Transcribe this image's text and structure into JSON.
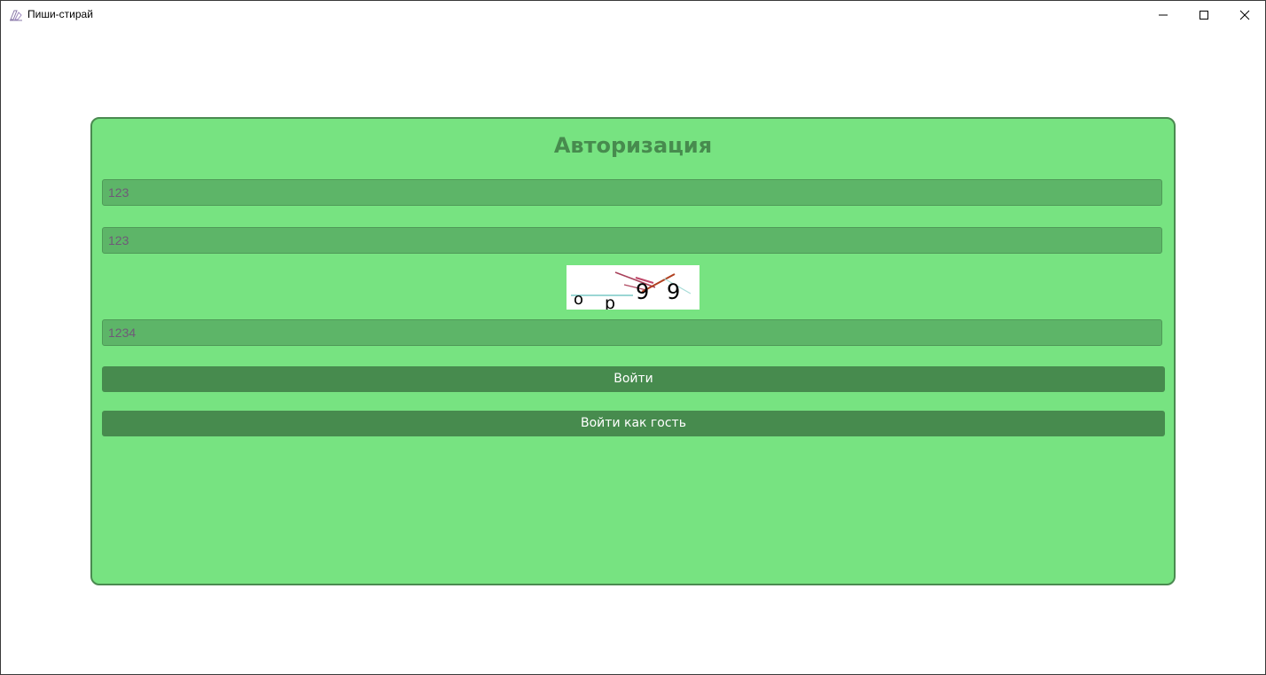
{
  "window": {
    "title": "Пиши-стирай",
    "icon": "app-pencil-icon"
  },
  "auth": {
    "title": "Авторизация",
    "login_value": "123",
    "password_value": "123",
    "captcha_value": "1234",
    "captcha_chars": [
      "o",
      "p",
      "9",
      "9"
    ],
    "login_button": "Войти",
    "guest_button": "Войти как гость"
  },
  "colors": {
    "card_background": "#77e381",
    "card_border": "#4a8a50",
    "field_background": "#5db568",
    "button_background": "#478b4e",
    "title_color": "#478b4e",
    "field_text": "#6f5a78"
  }
}
